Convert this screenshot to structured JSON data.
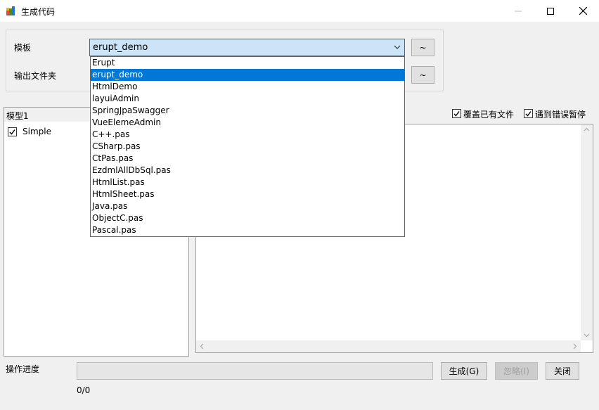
{
  "window": {
    "title": "生成代码",
    "minimize_icon": "minimize-icon",
    "maximize_icon": "maximize-icon",
    "close_icon": "close-icon"
  },
  "form": {
    "template_label": "模板",
    "output_folder_label": "输出文件夹",
    "template_value": "erupt_demo",
    "template_browse_label": "~",
    "output_browse_label": "~",
    "template_options": [
      "Erupt",
      "erupt_demo",
      "HtmlDemo",
      "layuiAdmin",
      "SpringJpaSwagger",
      "VueElemeAdmin",
      "C++.pas",
      "CSharp.pas",
      "CtPas.pas",
      "EzdmlAllDbSql.pas",
      "HtmlList.pas",
      "HtmlSheet.pas",
      "Java.pas",
      "ObjectC.pas",
      "Pascal.pas"
    ],
    "selected_index": 1
  },
  "models": {
    "tab_label": "模型1",
    "items": [
      {
        "label": "Simple",
        "checked": true
      }
    ]
  },
  "options": {
    "overwrite_label": "覆盖已有文件",
    "overwrite_checked": true,
    "pause_on_error_label": "遇到错误暂停",
    "pause_on_error_checked": true
  },
  "footer": {
    "progress_label": "操作进度",
    "progress_text": "0/0",
    "progress_fraction": 0,
    "generate_label": "生成(G)",
    "ignore_label": "忽略(I)",
    "close_label": "关闭"
  },
  "colors": {
    "accent": "#0078d7",
    "combo_bg": "#cce4f7"
  }
}
